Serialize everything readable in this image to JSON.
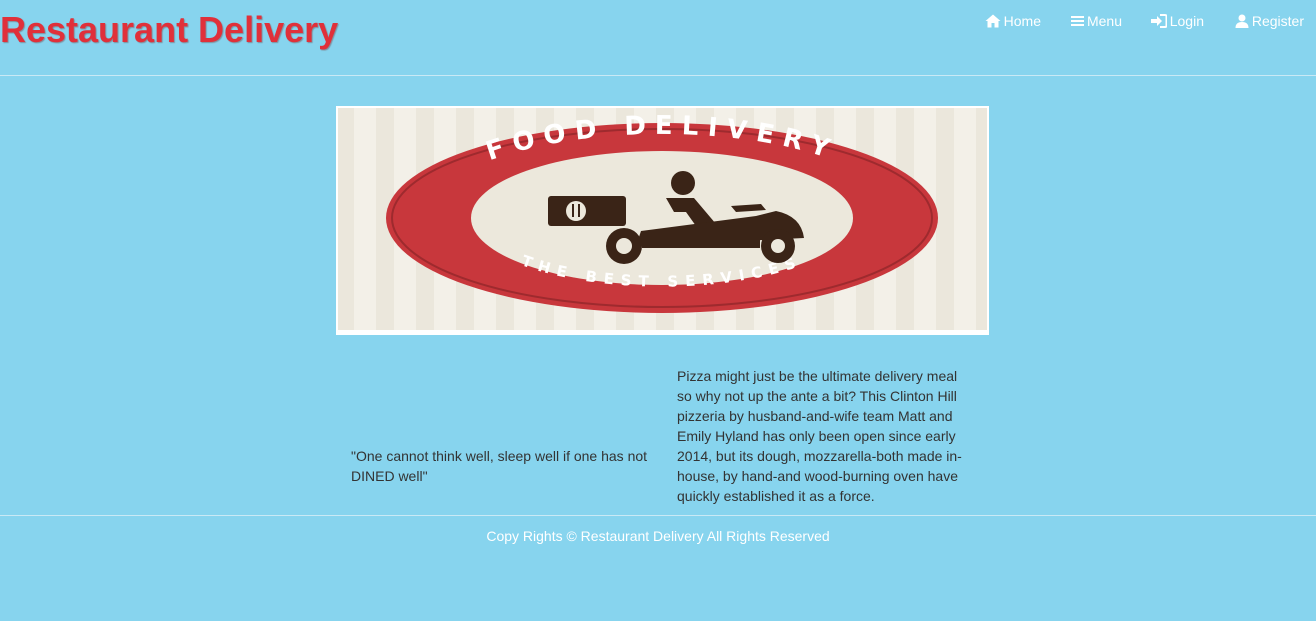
{
  "header": {
    "brand": "Restaurant Delivery",
    "brand_color": "#e0303a",
    "nav": [
      {
        "label": "Home",
        "icon": "home-icon"
      },
      {
        "label": "Menu",
        "icon": "menu-icon"
      },
      {
        "label": "Login",
        "icon": "login-icon"
      },
      {
        "label": "Register",
        "icon": "user-icon"
      }
    ]
  },
  "banner": {
    "top_text": "FOOD DELIVERY",
    "bottom_text": "THE BEST SERVICES",
    "ring_color": "#c8373c",
    "icon": "scooter-delivery-icon"
  },
  "content": {
    "quote": "\"One cannot think well, sleep well if one has not DINED well\"",
    "description": "Pizza might just be the ultimate delivery meal so why not up the ante a bit? This Clinton Hill pizzeria by husband-and-wife team Matt and Emily Hyland has only been open since early 2014, but its dough, mozzarella-both made in-house, by hand-and wood-burning oven have quickly established it as a force."
  },
  "footer": {
    "text": "Copy Rights © Restaurant Delivery All Rights Reserved"
  },
  "colors": {
    "background": "#87d4ee",
    "text": "#333333",
    "nav_text": "#ffffff"
  }
}
